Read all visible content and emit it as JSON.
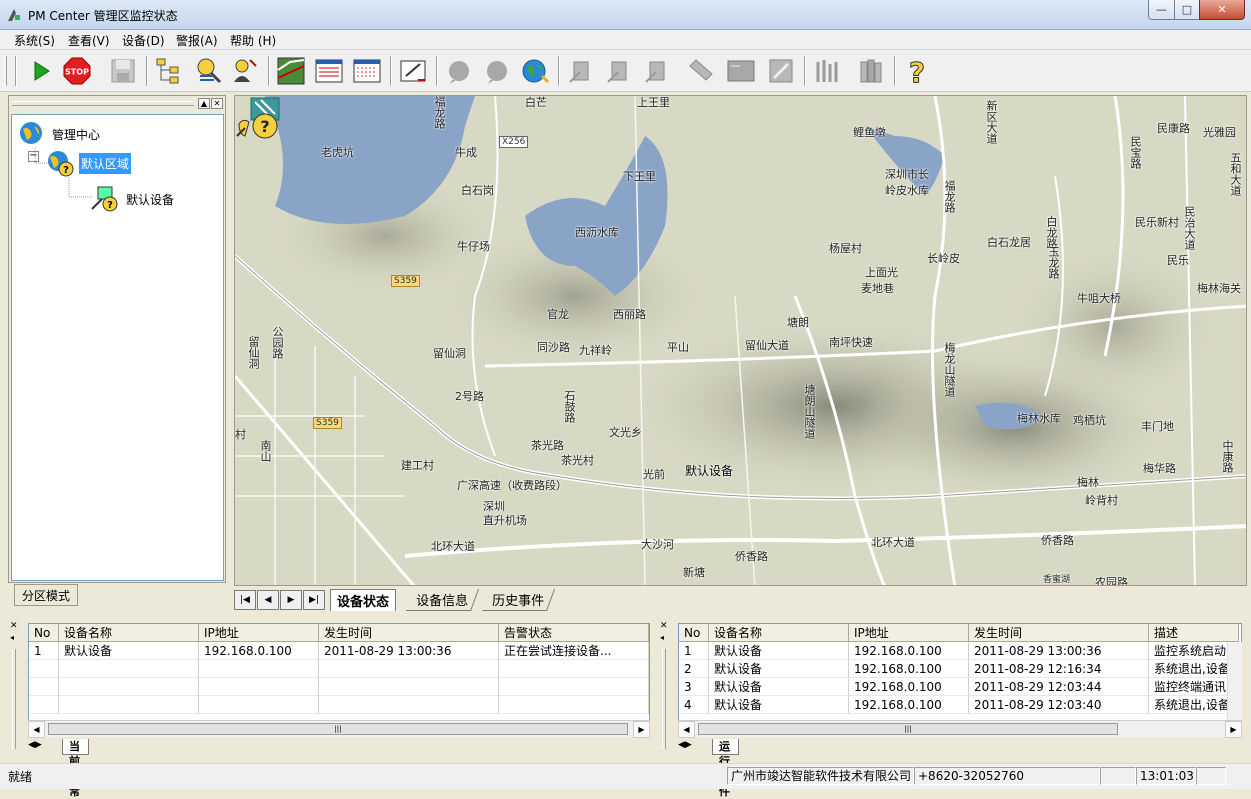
{
  "window": {
    "title": "PM Center 管理区监控状态",
    "min": "—",
    "max": "□",
    "close": "✕"
  },
  "menu": [
    {
      "label": "系统(S)"
    },
    {
      "label": "查看(V)"
    },
    {
      "label": "设备(D)"
    },
    {
      "label": "警报(A)"
    },
    {
      "label": "帮助 (H)"
    }
  ],
  "toolbar": {
    "buttons": [
      "play-icon",
      "stop-icon",
      "save-icon",
      "tree-icon",
      "search-alarm-icon",
      "alarm-user-icon",
      "line-chart-icon",
      "window-list-icon",
      "window-red-icon",
      "edit-icon",
      "bubble-icon",
      "bubble2-icon",
      "globe-icon",
      "device1-icon",
      "device2-icon",
      "device3-icon",
      "device4-icon",
      "terminal-icon",
      "wrench-icon",
      "tools-icon",
      "books-icon",
      "help-icon"
    ],
    "stop_label": "STOP"
  },
  "tree": {
    "root": "管理中心",
    "zone": "默认区域",
    "device": "默认设备",
    "expander": "−"
  },
  "zone_mode_button": "分区模式",
  "map": {
    "labels": {
      "l1": "老虎坑",
      "l2": "牛成",
      "l3": "白石岗",
      "l4": "牛仔场",
      "l5": "西沥水库",
      "l6": "下王里",
      "l7": "上王里",
      "l8": "白芒",
      "l9": "官龙",
      "l10": "西丽路",
      "l11": "同沙路",
      "l12": "九祥岭",
      "l13": "平山",
      "l14": "留仙大道",
      "l15": "留仙洞",
      "l16": "2号路",
      "l17": "石鼓路",
      "l18": "文光乡",
      "l19": "茶光路",
      "l20": "茶光村",
      "l21": "建工村",
      "l22": "广深高速（收费路段）",
      "l23": "深圳",
      "l24": "直升机场",
      "l25": "光前",
      "l26": "北环大道",
      "l27": "大沙河",
      "l28": "新塘",
      "l29": "侨香路",
      "l30": "鲤鱼墩",
      "l31": "深圳市长岭皮水库",
      "l32": "杨屋村",
      "l33": "长岭皮",
      "l34": "上面光",
      "l35": "麦地巷",
      "l36": "塘朗",
      "l37": "南坪快速",
      "l38": "白石龙居",
      "l39": "民乐新村",
      "l40": "民乐",
      "l41": "梅林海关",
      "l42": "牛咀大桥",
      "l43": "梅林水库",
      "l44": "鸡栖坑",
      "l45": "丰门地",
      "l46": "梅林",
      "l47": "梅华路",
      "l48": "岭背村",
      "l49": "北环大道",
      "l50": "侨香路",
      "l51": "香蜜湖",
      "l52": "农园路",
      "l53": "民康路",
      "l54": "光雅园",
      "l55": "五和大道",
      "l56": "民治大道",
      "l57": "新区大道",
      "l58": "福龙路",
      "l59": "梅龙山隧道",
      "l60": "塘朗山隧道",
      "l61": "留仙洞",
      "l62": "公园路",
      "l63": "南山",
      "l64": "中康路",
      "l65": "民宝路",
      "l66": "白龙路",
      "l67": "玉龙路",
      "l68": "福龙路",
      "l69": "村"
    },
    "shields": {
      "s1": "X256",
      "s2": "S359",
      "s3": "S359"
    },
    "device_label": "默认设备"
  },
  "tabs": {
    "active": "设备状态",
    "t2": "设备信息",
    "t3": "历史事件"
  },
  "alarms": {
    "headers": [
      "No",
      "设备名称",
      "IP地址",
      "发生时间",
      "告警状态"
    ],
    "rows": [
      [
        "1",
        "默认设备",
        "192.168.0.100",
        "2011-08-29 13:00:36",
        "正在尝试连接设备..."
      ]
    ],
    "tab": "当前异常"
  },
  "events": {
    "headers": [
      "No",
      "设备名称",
      "IP地址",
      "发生时间",
      "描述"
    ],
    "rows": [
      [
        "1",
        "默认设备",
        "192.168.0.100",
        "2011-08-29 13:00:36",
        "监控系统启动"
      ],
      [
        "2",
        "默认设备",
        "192.168.0.100",
        "2011-08-29 12:16:34",
        "系统退出,设备"
      ],
      [
        "3",
        "默认设备",
        "192.168.0.100",
        "2011-08-29 12:03:44",
        "监控终端通讯"
      ],
      [
        "4",
        "默认设备",
        "192.168.0.100",
        "2011-08-29 12:03:40",
        "系统退出,设备"
      ]
    ],
    "tab": "运行事件"
  },
  "status": {
    "left": "就绪",
    "company": "广州市竣达智能软件技术有限公司",
    "phone": "+8620-32052760",
    "time": "13:01:03"
  }
}
